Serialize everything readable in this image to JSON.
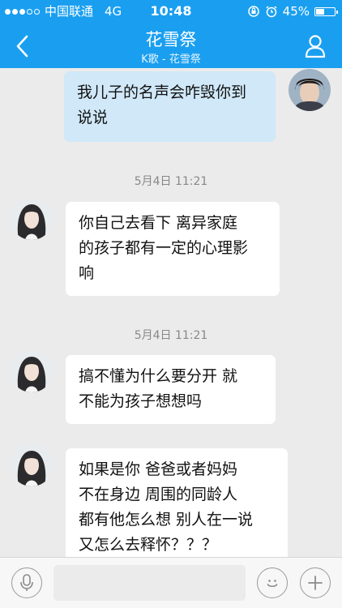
{
  "status_bar": {
    "carrier": "中国联通",
    "network": "4G",
    "time": "10:48",
    "battery": "45%",
    "battery_level": 0.45,
    "signal_bars": 3
  },
  "header": {
    "title": "花雪祭",
    "subtitle": "K歌 - 花雪祭",
    "background": "#1a9ff0"
  },
  "messages": [
    {
      "kind": "sent",
      "lines": [
        "我儿子的名声会咋毁你到",
        "说说"
      ]
    },
    {
      "kind": "time",
      "text": "5月4日 11:21"
    },
    {
      "kind": "received",
      "lines": [
        "你自己去看下   离异家庭",
        "的孩子都有一定的心理影",
        "响"
      ]
    },
    {
      "kind": "time",
      "text": "5月4日 11:21"
    },
    {
      "kind": "received",
      "lines": [
        "搞不懂为什么要分开   就",
        "不能为孩子想想吗"
      ]
    },
    {
      "kind": "received",
      "lines": [
        "如果是你   爸爸或者妈妈",
        "不在身边   周围的同龄人",
        "都有他怎么想  别人在一说",
        "又怎么去释怀？？？"
      ]
    }
  ],
  "input_bar": {
    "voice_icon": "microphone-icon",
    "emoji_icon": "smiley-icon",
    "more_icon": "plus-icon",
    "placeholder": ""
  },
  "colors": {
    "sent_bubble": "#d0e8f8",
    "received_bubble": "#ffffff",
    "background": "#ebebeb"
  }
}
